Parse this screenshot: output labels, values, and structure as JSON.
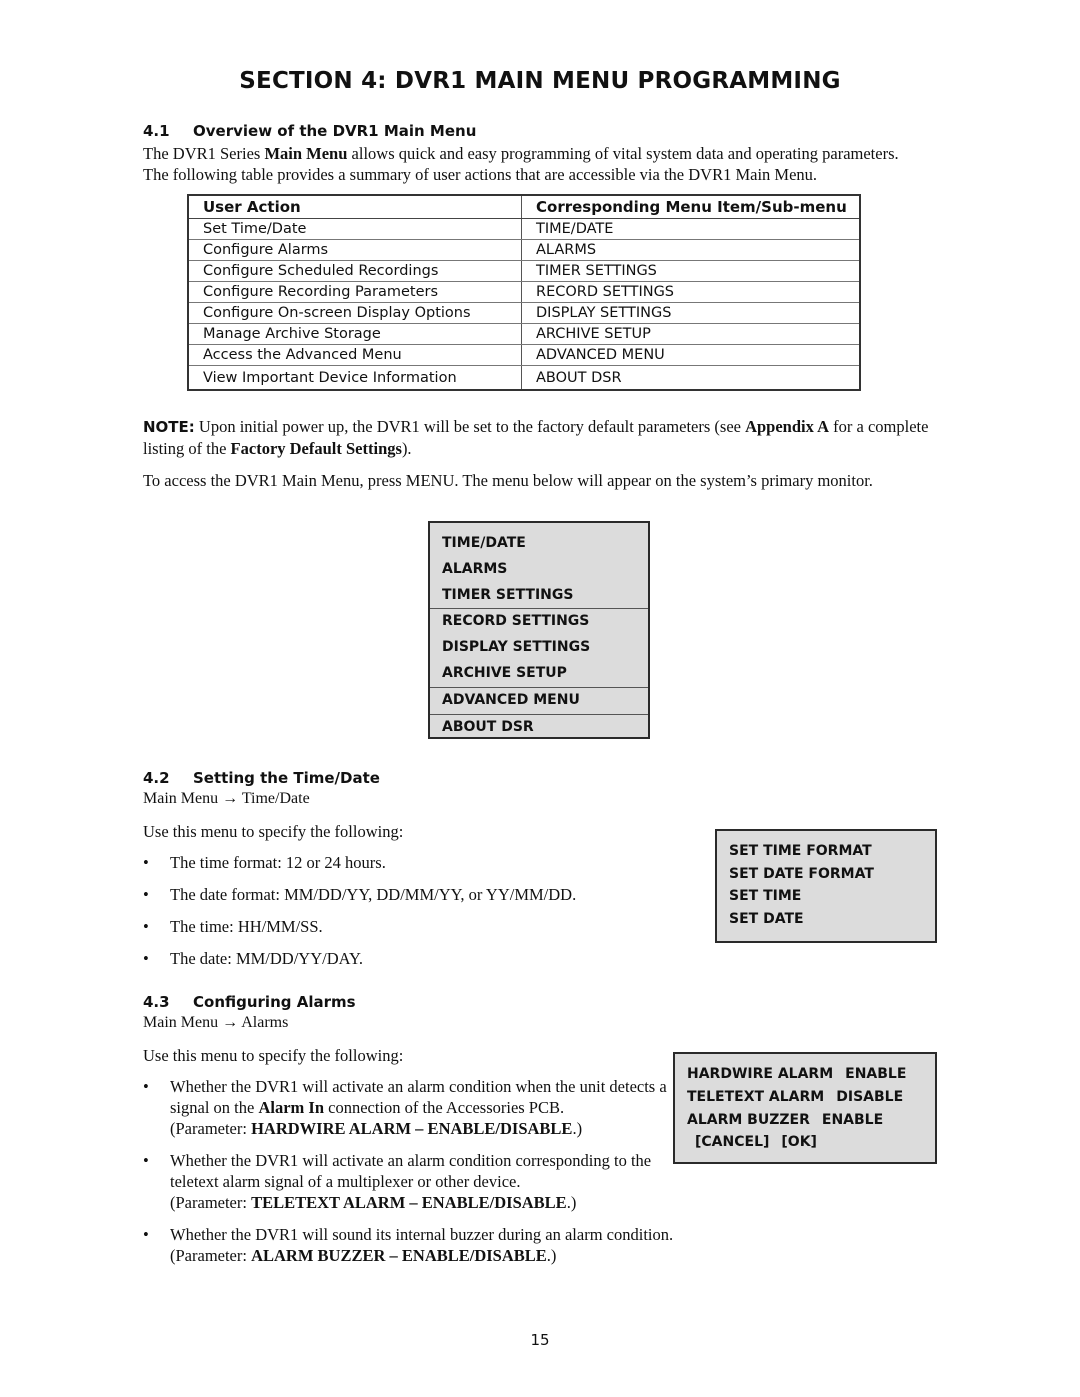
{
  "page_title": "SECTION 4:  DVR1 MAIN MENU PROGRAMMING",
  "section_4_1": {
    "number": "4.1",
    "heading": "Overview of the DVR1 Main Menu",
    "intro": {
      "p1_a": "The DVR1 Series ",
      "p1_b": "Main Menu",
      "p1_c": " allows quick and easy programming of vital system data and operating parameters.",
      "p2": "The following table provides a summary of user actions that are accessible via the DVR1 Main Menu."
    },
    "table": {
      "headers": [
        "User Action",
        "Corresponding Menu Item/Sub-menu"
      ],
      "rows": [
        [
          "Set Time/Date",
          "TIME/DATE"
        ],
        [
          "Configure Alarms",
          "ALARMS"
        ],
        [
          "Configure Scheduled Recordings",
          "TIMER SETTINGS"
        ],
        [
          "Configure Recording Parameters",
          "RECORD SETTINGS"
        ],
        [
          "Configure On-screen Display Options",
          "DISPLAY SETTINGS"
        ],
        [
          "Manage Archive Storage",
          "ARCHIVE SETUP"
        ],
        [
          "Access the Advanced Menu",
          "ADVANCED MENU"
        ],
        [
          "View Important Device Information",
          "ABOUT DSR"
        ]
      ]
    },
    "note": {
      "label": "NOTE:",
      "a": " Upon initial power up, the DVR1 will be set to the factory default parameters (see ",
      "b": "Appendix A",
      "c": " for a complete listing of the ",
      "d": "Factory Default Settings",
      "e": ")."
    },
    "access": {
      "a": "To access the DVR1 Main Menu, press ",
      "b": "MENU",
      "c": ". The menu below will appear on the system’s primary monitor."
    },
    "main_menu_items": [
      "TIME/DATE",
      "ALARMS",
      "TIMER SETTINGS",
      "RECORD SETTINGS",
      "DISPLAY SETTINGS",
      "ARCHIVE SETUP",
      "ADVANCED MENU",
      "ABOUT DSR"
    ]
  },
  "section_4_2": {
    "number": "4.2",
    "heading": "Setting the Time/Date",
    "path": "Main Menu → Time/Date",
    "lead": "Use this menu to specify the following:",
    "bullets": [
      "The time format: 12 or 24 hours.",
      "The date format: MM/DD/YY, DD/MM/YY, or YY/MM/DD.",
      "The time: HH/MM/SS.",
      "The date: MM/DD/YY/DAY."
    ],
    "menu_items": [
      "SET TIME FORMAT",
      "SET DATE FORMAT",
      "SET TIME",
      "SET DATE"
    ]
  },
  "section_4_3": {
    "number": "4.3",
    "heading": "Configuring Alarms",
    "path": "Main Menu → Alarms",
    "lead": "Use this menu to specify the following:",
    "bullets": [
      {
        "a": "Whether the DVR1 will activate an alarm condition when the unit detects a signal on the ",
        "b": "Alarm In",
        "c": " connection of the Accessories PCB.",
        "param_prefix": "(Parameter: ",
        "param": "HARDWIRE ALARM – ENABLE/DISABLE",
        "param_suffix": ".)"
      },
      {
        "a": "Whether the DVR1 will activate an alarm condition corresponding to the teletext alarm signal of a multiplexer or other device.",
        "param_prefix": "(Parameter: ",
        "param": "TELETEXT ALARM – ENABLE/DISABLE",
        "param_suffix": ".)"
      },
      {
        "a": "Whether the DVR1 will sound its internal buzzer during an alarm condition.",
        "param_prefix": "(Parameter: ",
        "param": "ALARM BUZZER – ENABLE/DISABLE",
        "param_suffix": ".)"
      }
    ],
    "menu_rows": [
      {
        "label": "HARDWIRE ALARM",
        "value": "ENABLE"
      },
      {
        "label": "TELETEXT ALARM",
        "value": "DISABLE"
      },
      {
        "label": "ALARM BUZZER",
        "value": "ENABLE"
      }
    ],
    "cancel_label": "[CANCEL]",
    "ok_label": "[OK]"
  },
  "page_number": "15"
}
